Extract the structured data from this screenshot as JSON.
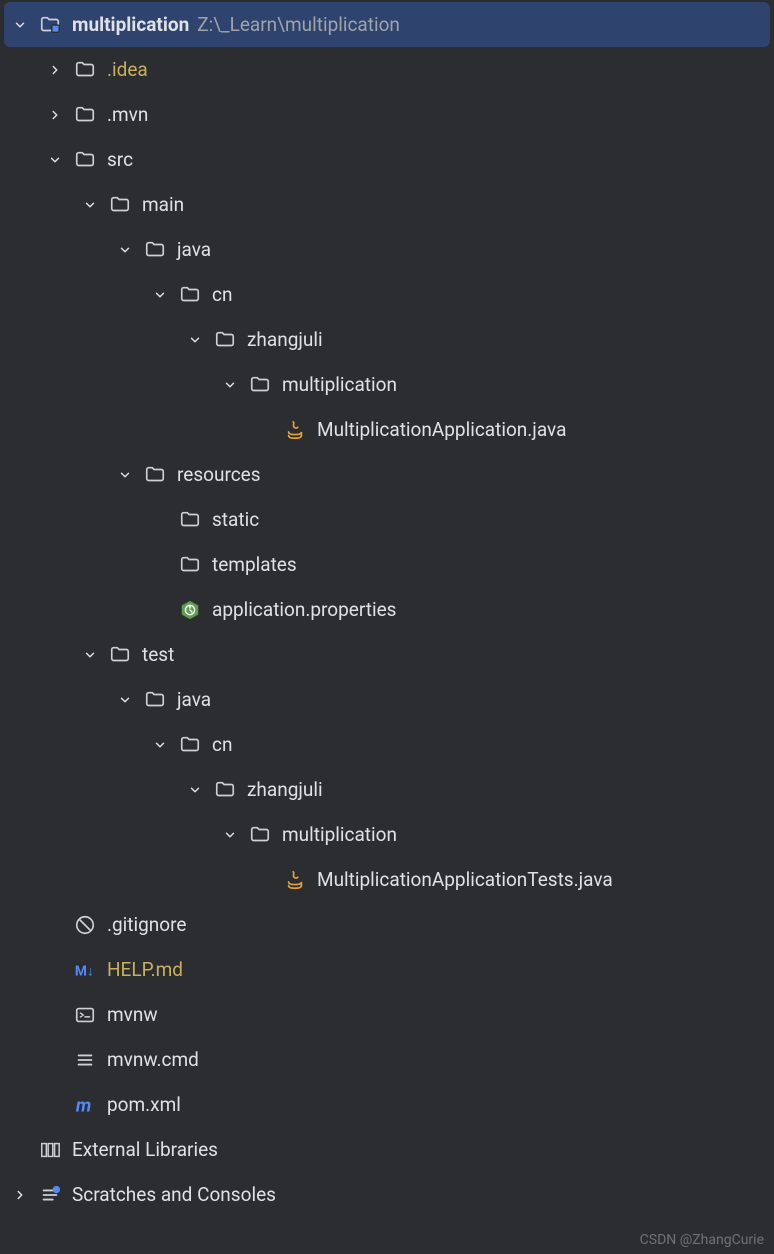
{
  "root": {
    "name": "multiplication",
    "path": "Z:\\_Learn\\multiplication"
  },
  "nodes": {
    "idea": ".idea",
    "mvn": ".mvn",
    "src": "src",
    "main": "main",
    "java1": "java",
    "cn1": "cn",
    "zhangjuli1": "zhangjuli",
    "multpkg1": "multiplication",
    "appjava": "MultiplicationApplication.java",
    "resources": "resources",
    "static": "static",
    "templates": "templates",
    "appprops": "application.properties",
    "test": "test",
    "java2": "java",
    "cn2": "cn",
    "zhangjuli2": "zhangjuli",
    "multpkg2": "multiplication",
    "testjava": "MultiplicationApplicationTests.java",
    "gitignore": ".gitignore",
    "helpmd": "HELP.md",
    "mvnw": "mvnw",
    "mvnwcmd": "mvnw.cmd",
    "pomxml": "pom.xml",
    "extlib": "External Libraries",
    "scratches": "Scratches and Consoles"
  },
  "watermark": "CSDN @ZhangCurie"
}
